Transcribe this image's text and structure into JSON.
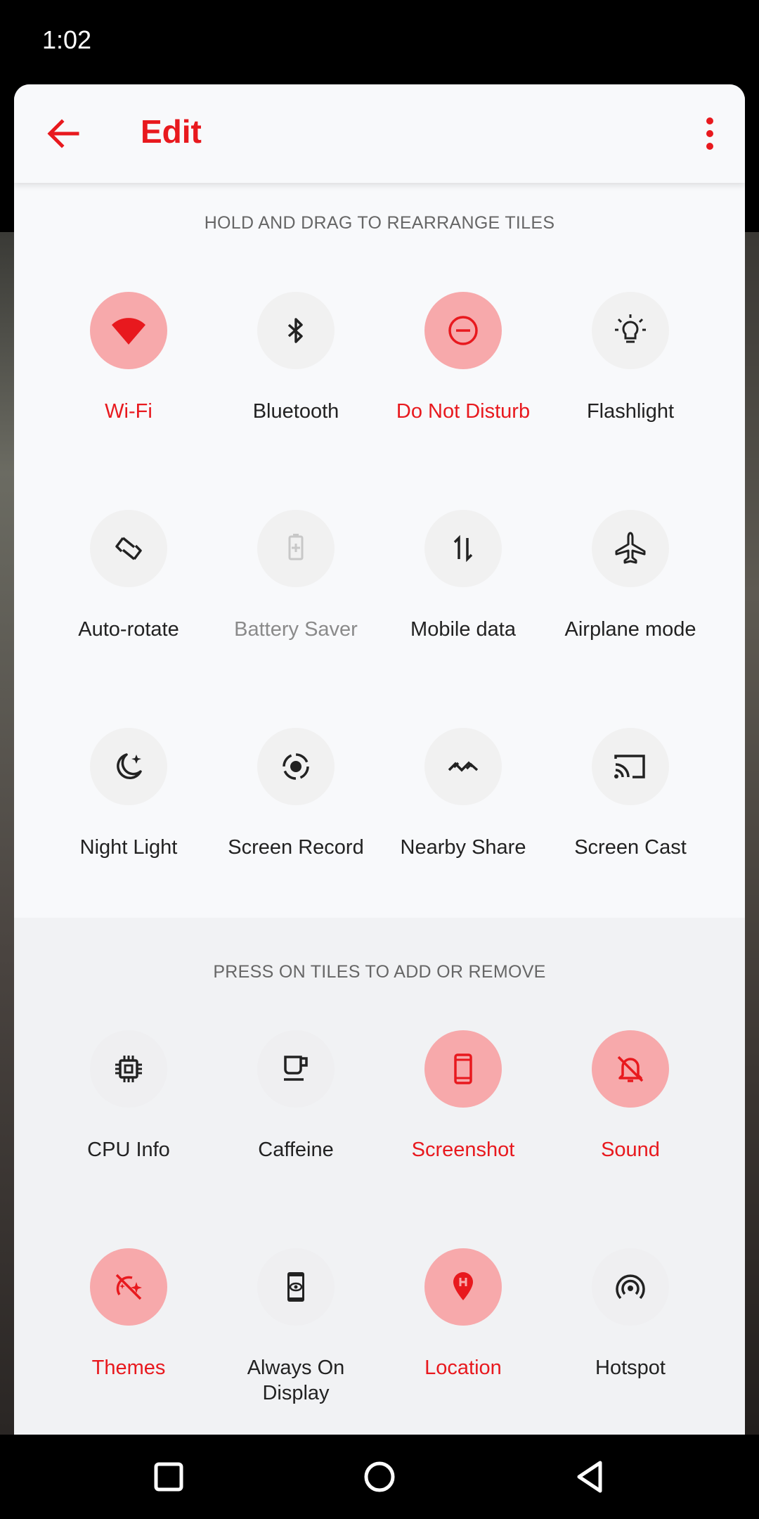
{
  "status_bar": {
    "time": "1:02"
  },
  "header": {
    "title": "Edit"
  },
  "active_section": {
    "label": "HOLD AND DRAG TO REARRANGE TILES",
    "tiles": [
      {
        "label": "Wi-Fi",
        "icon": "wifi-icon",
        "state": "on"
      },
      {
        "label": "Bluetooth",
        "icon": "bluetooth-icon",
        "state": "off"
      },
      {
        "label": "Do Not Disturb",
        "icon": "do-not-disturb-icon",
        "state": "on"
      },
      {
        "label": "Flashlight",
        "icon": "flashlight-icon",
        "state": "off"
      },
      {
        "label": "Auto-rotate",
        "icon": "auto-rotate-icon",
        "state": "off"
      },
      {
        "label": "Battery Saver",
        "icon": "battery-saver-icon",
        "state": "unavailable"
      },
      {
        "label": "Mobile data",
        "icon": "mobile-data-icon",
        "state": "off"
      },
      {
        "label": "Airplane mode",
        "icon": "airplane-icon",
        "state": "off"
      },
      {
        "label": "Night Light",
        "icon": "night-light-icon",
        "state": "off"
      },
      {
        "label": "Screen Record",
        "icon": "screen-record-icon",
        "state": "off"
      },
      {
        "label": "Nearby Share",
        "icon": "nearby-share-icon",
        "state": "off"
      },
      {
        "label": "Screen Cast",
        "icon": "screen-cast-icon",
        "state": "off"
      }
    ]
  },
  "available_section": {
    "label": "PRESS ON TILES TO ADD OR REMOVE",
    "tiles": [
      {
        "label": "CPU Info",
        "icon": "cpu-icon",
        "state": "off"
      },
      {
        "label": "Caffeine",
        "icon": "caffeine-icon",
        "state": "off"
      },
      {
        "label": "Screenshot",
        "icon": "screenshot-icon",
        "state": "on"
      },
      {
        "label": "Sound",
        "icon": "sound-off-icon",
        "state": "on"
      },
      {
        "label": "Themes",
        "icon": "themes-icon",
        "state": "on"
      },
      {
        "label": "Always On Display",
        "icon": "always-on-display-icon",
        "state": "off"
      },
      {
        "label": "Location",
        "icon": "location-icon",
        "state": "on"
      },
      {
        "label": "Hotspot",
        "icon": "hotspot-icon",
        "state": "off"
      }
    ]
  },
  "colors": {
    "accent": "#e8191e",
    "active_tile": "#f7a9ab",
    "inactive_tile": "#f1f1f1",
    "panel": "#f8f9fb"
  }
}
